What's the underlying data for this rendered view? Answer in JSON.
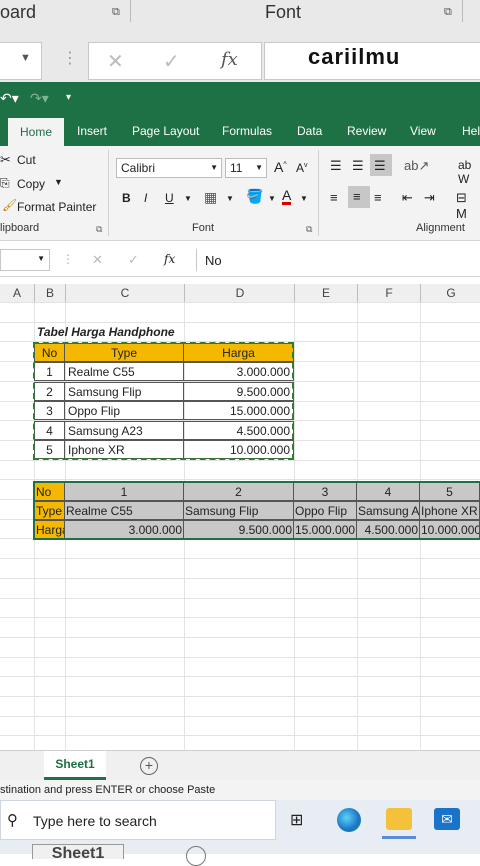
{
  "overlay": {
    "ghost_clipboard": "oard",
    "ghost_font": "Font",
    "watermark": "cariilmu"
  },
  "tabs": [
    "Home",
    "Insert",
    "Page Layout",
    "Formulas",
    "Data",
    "Review",
    "View",
    "Hel"
  ],
  "ribbon": {
    "cut": "Cut",
    "copy": "Copy",
    "format_painter": "Format Painter",
    "clipboard_label": "lipboard",
    "font_name": "Calibri",
    "font_size": "11",
    "font_label": "Font",
    "alignment_label": "Alignment"
  },
  "formula_bar": {
    "fx": "fx",
    "content": "No"
  },
  "columns": [
    "A",
    "B",
    "C",
    "D",
    "E",
    "F",
    "G"
  ],
  "table1": {
    "title": "Tabel Harga Handphone",
    "headers": [
      "No",
      "Type",
      "Harga"
    ],
    "rows": [
      [
        "1",
        "Realme C55",
        "3.000.000"
      ],
      [
        "2",
        "Samsung Flip",
        "9.500.000"
      ],
      [
        "3",
        "Oppo Flip",
        "15.000.000"
      ],
      [
        "4",
        "Samsung A23",
        "4.500.000"
      ],
      [
        "5",
        "Iphone XR",
        "10.000.000"
      ]
    ]
  },
  "table2": {
    "row_no": [
      "No",
      "1",
      "2",
      "3",
      "4",
      "5"
    ],
    "row_type": [
      "Type",
      "Realme C55",
      "Samsung Flip",
      "Oppo Flip",
      "Samsung A",
      "Iphone XR"
    ],
    "row_harga": [
      "Harga",
      "3.000.000",
      "9.500.000",
      "15.000.000",
      "4.500.000",
      "10.000.000"
    ]
  },
  "sheet_tab": "Sheet1",
  "status_text": "stination and press ENTER or choose Paste",
  "taskbar": {
    "search_placeholder": "Type here to search",
    "ghost_sheet": "Sheet1"
  }
}
